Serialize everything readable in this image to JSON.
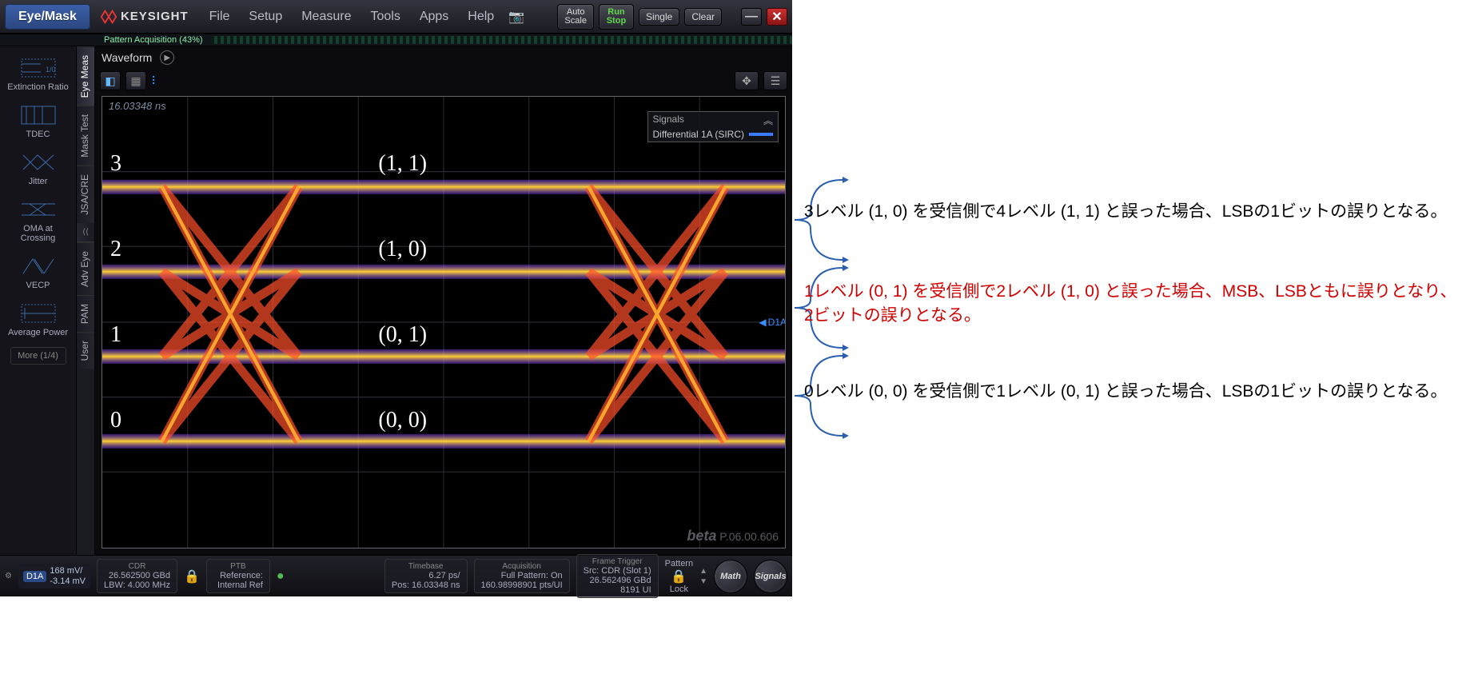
{
  "menubar": {
    "eye_mask": "Eye/Mask",
    "brand": "KEYSIGHT",
    "items": [
      "File",
      "Setup",
      "Measure",
      "Tools",
      "Apps",
      "Help"
    ],
    "autoscale_l1": "Auto",
    "autoscale_l2": "Scale",
    "runstop_l1": "Run",
    "runstop_l2": "Stop",
    "single": "Single",
    "clear": "Clear"
  },
  "pattern_strip": {
    "label": "Pattern Acquisition    (43%)"
  },
  "rail": {
    "items": [
      {
        "label": "Extinction Ratio"
      },
      {
        "label": "TDEC"
      },
      {
        "label": "Jitter"
      },
      {
        "label": "OMA at Crossing"
      },
      {
        "label": "VECP"
      },
      {
        "label": "Average Power"
      }
    ],
    "more": "More (1/4)"
  },
  "vtabs": [
    "Eye Meas",
    "Mask Test",
    "JSA/CRE",
    "Adv Eye",
    "PAM",
    "User"
  ],
  "wave_header": {
    "title": "Waveform"
  },
  "plot": {
    "timestamp": "16.03348 ns",
    "legend_title": "Signals",
    "legend_row": "Differential 1A (SIRC)",
    "marker": "D1A",
    "levels": [
      "3",
      "2",
      "1",
      "0"
    ],
    "pairs": [
      "(1, 1)",
      "(1, 0)",
      "(0, 1)",
      "(0, 0)"
    ],
    "beta": "beta",
    "version": "P.06.00.606"
  },
  "status": {
    "ch_tag": "D1A",
    "ch_v1": "168 mV/",
    "ch_v2": "-3.14 mV",
    "cdr_title": "CDR",
    "cdr_l1": "26.562500 GBd",
    "cdr_l2": "LBW:  4.000 MHz",
    "ptb_title": "PTB",
    "ptb_l1": "Reference:",
    "ptb_l2": "Internal Ref",
    "timebase_title": "Timebase",
    "timebase_l1": "6.27 ps/",
    "timebase_l2": "Pos: 16.03348 ns",
    "acq_title": "Acquisition",
    "acq_l1": "Full Pattern: On",
    "acq_l2": "160.98998901 pts/UI",
    "ft_title": "Frame Trigger",
    "ft_l1": "Src: CDR (Slot 1)",
    "ft_l2": "26.562496 GBd",
    "ft_l3": "8191 UI",
    "pattern": "Pattern",
    "lock": "Lock",
    "math": "Math",
    "signals": "Signals"
  },
  "annotations": {
    "a1": "3レベル (1, 0) を受信側で4レベル (1, 1) と誤った場合、LSBの1ビットの誤りとなる。",
    "a2": "1レベル (0, 1) を受信側で2レベル (1, 0) と誤った場合、MSB、LSBともに誤りとなり、2ビットの誤りとなる。",
    "a3": "0レベル (0, 0) を受信側で1レベル (0, 1) と誤った場合、LSBの1ビットの誤りとなる。"
  }
}
